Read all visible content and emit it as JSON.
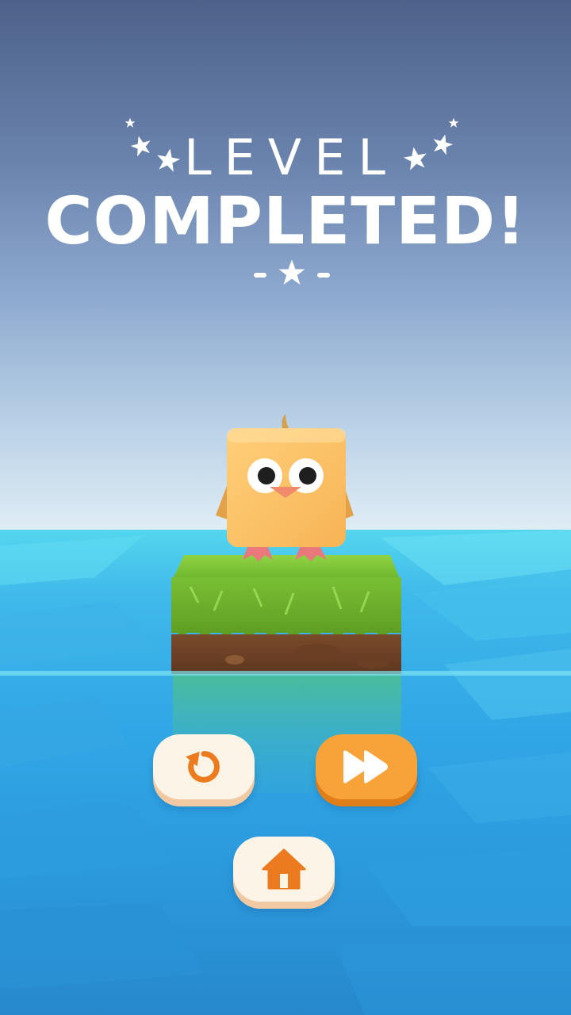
{
  "header": {
    "level_label": "LEVEL",
    "completed_label": "COMPLETED!"
  },
  "buttons": {
    "restart_icon": "restart-icon",
    "next_icon": "fast-forward-icon",
    "home_icon": "home-icon"
  },
  "colors": {
    "accent_orange": "#f8a23a",
    "button_light": "#fdf4e8",
    "icon_orange": "#ec7a1e"
  }
}
